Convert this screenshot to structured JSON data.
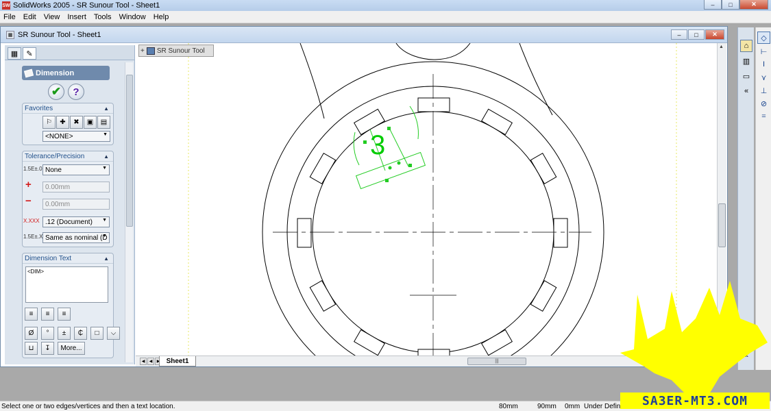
{
  "app": {
    "title": "SolidWorks 2005 - SR Sunour Tool - Sheet1",
    "icon_text": "SW"
  },
  "window_controls": {
    "minimize": "–",
    "maximize": "□",
    "close": "✕"
  },
  "menu": [
    "File",
    "Edit",
    "View",
    "Insert",
    "Tools",
    "Window",
    "Help"
  ],
  "document": {
    "title": "SR Sunour Tool - Sheet1",
    "tree_label": "SR Sunour Tool",
    "sheet_tab": "Sheet1"
  },
  "property_manager": {
    "title": "Dimension",
    "ok": "✔",
    "help": "?",
    "favorites": {
      "label": "Favorites",
      "selected": "<NONE>"
    },
    "tolerance": {
      "label": "Tolerance/Precision",
      "type": "None",
      "plus_value": "0.00mm",
      "minus_value": "0.00mm",
      "precision": ".12 (Document)",
      "tol_precision": "Same as nominal (D"
    },
    "dimension_text": {
      "label": "Dimension Text",
      "value": "<DIM>",
      "more_button": "More..."
    }
  },
  "drawing": {
    "dimension_value": "3"
  },
  "status": {
    "message": "Select one or two edges/vertices and then a text location.",
    "x": "80mm",
    "y": "90mm",
    "z": "0mm",
    "state": "Under Defin"
  },
  "watermark": {
    "text": "SA3ER-MT3.COM"
  },
  "colors": {
    "sketch_selected": "#22cc22",
    "dimension_green": "#00cc00",
    "watermark": "#ffff00"
  }
}
